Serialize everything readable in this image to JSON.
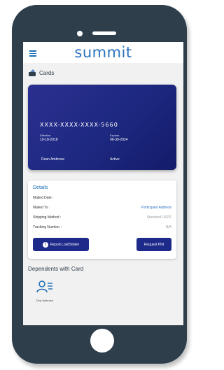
{
  "app": {
    "logo_text": "summit"
  },
  "section": {
    "title": "Cards"
  },
  "card": {
    "number": "XXXX-XXXX-XXXX-5660",
    "effective_label": "Effective",
    "effective_date": "10-18-2018",
    "expires_label": "Expires",
    "expires_date": "06-30-2024",
    "holder": "Dean Ambrose",
    "status": "Active"
  },
  "details": {
    "title": "Details",
    "rows": [
      {
        "label": "Mailed Date :",
        "value": ""
      },
      {
        "label": "Mailed To :",
        "value": "Participant Address"
      },
      {
        "label": "Shipping Method :",
        "value": "Standard USPS"
      },
      {
        "label": "Tracking Number :",
        "value": "N/A"
      }
    ],
    "report_button": "Report Lost/Stolen",
    "pin_button": "Request PIN"
  },
  "dependents": {
    "title": "Dependents with Card",
    "items": [
      {
        "name": "Dep Ambrose"
      }
    ]
  },
  "colors": {
    "accent": "#2a74bf",
    "card_blue": "#1f2a84",
    "button_blue": "#1d2a8a",
    "phone_frame": "#2f3e4b"
  }
}
